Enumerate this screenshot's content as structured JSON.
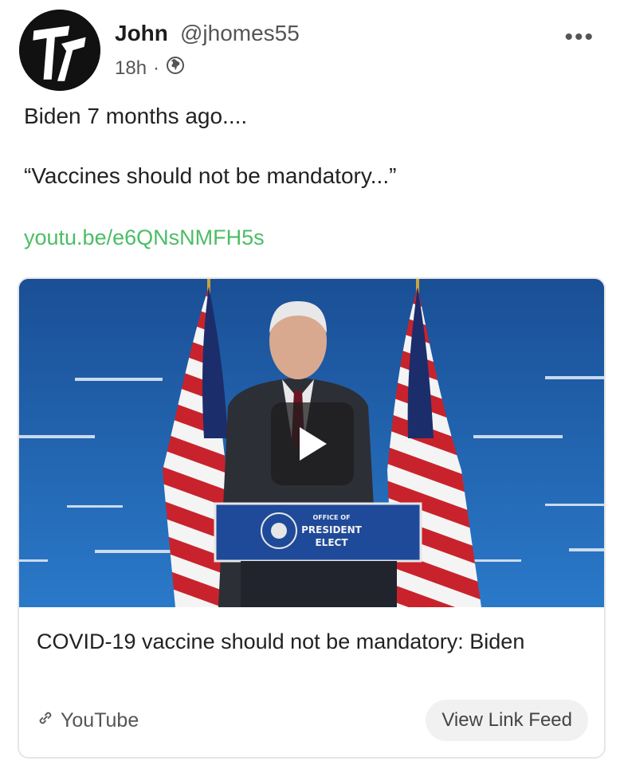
{
  "post": {
    "author_name": "John",
    "author_handle": "@jhomes55",
    "time": "18h",
    "separator": "·",
    "visibility_icon": "globe-icon",
    "more_label": "•••",
    "text_line1": "Biden 7 months ago....",
    "text_line2": "“Vaccines should not be mandatory...”",
    "link_text": "youtu.be/e6QNsNMFH5s"
  },
  "card": {
    "thumbnail_podium_lines": [
      "OFFICE OF",
      "PRESIDENT",
      "ELECT"
    ],
    "title": "COVID-19 vaccine should not be mandatory: Biden",
    "source_icon": "link-icon",
    "source": "YouTube",
    "feed_button": "View Link Feed"
  },
  "colors": {
    "link": "#4cbd64",
    "thumbnail_bg": "#1d5fa8",
    "button_bg": "#f1f1f1"
  }
}
